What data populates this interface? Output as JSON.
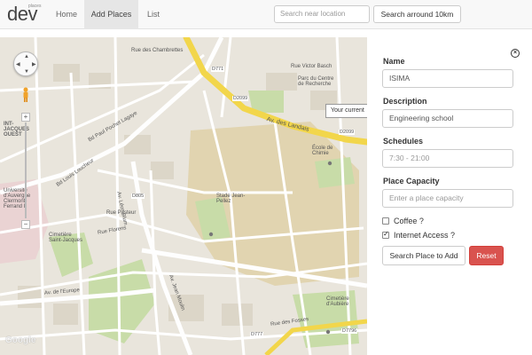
{
  "brand": {
    "name": "dev",
    "sub": "places"
  },
  "nav": {
    "items": [
      {
        "label": "Home"
      },
      {
        "label": "Add Places"
      },
      {
        "label": "List"
      }
    ]
  },
  "search": {
    "placeholder": "Search near location",
    "button_label": "Search arround 10km"
  },
  "map": {
    "tooltip": "Your current",
    "provider_logo": "Google",
    "labels": {
      "bd_paul": "Bd Paul Pochet Lagaye",
      "bd_louis": "Bd Louis Loucheur",
      "av_landais": "Av. des Landais",
      "av_leon_blum": "Av. Léon Blum",
      "av_jean_moulin": "Av. Jean Moulin",
      "stade": "Stade Jean-Pellez",
      "ecole": "École de Chimie",
      "cimetiere1": "Cimetière Saint-Jacques",
      "cimetiere2": "Cimetière d'Aubière",
      "av_europe": "Av. de l'Europe",
      "rue_fosses": "Rue des Fosses",
      "d771": "D771",
      "d2099a": "D2099",
      "d2099b": "D2099",
      "d805": "D805",
      "d777": "D777",
      "d7796": "D7796",
      "univ": "Université d'Auvergne Clermont-Ferrand I",
      "saint_jacques": "INT-JACQUES OUEST",
      "parc": "Parc du Centre de Recherche",
      "rue_pasteur": "Rue Pasteur",
      "rue_florens": "Rue Florens",
      "rue_chambrettes": "Rue des Chambrettes",
      "rue_victor_basch": "Rue Victor Basch"
    }
  },
  "form": {
    "name": {
      "label": "Name",
      "value": "ISIMA"
    },
    "description": {
      "label": "Description",
      "value": "Engineering school"
    },
    "schedules": {
      "label": "Schedules",
      "placeholder": "7:30 - 21:00"
    },
    "capacity": {
      "label": "Place Capacity",
      "placeholder": "Enter a place capacity"
    },
    "coffee": {
      "label": "Coffee ?",
      "checked": false
    },
    "internet": {
      "label": "Internet Access ?",
      "checked": true
    },
    "search_button": "Search Place to Add",
    "reset_button": "Reset"
  },
  "colors": {
    "reset": "#d9534f",
    "road_major": "#f2d64b",
    "park": "#c8dca8",
    "campus": "#e1d4b0"
  }
}
